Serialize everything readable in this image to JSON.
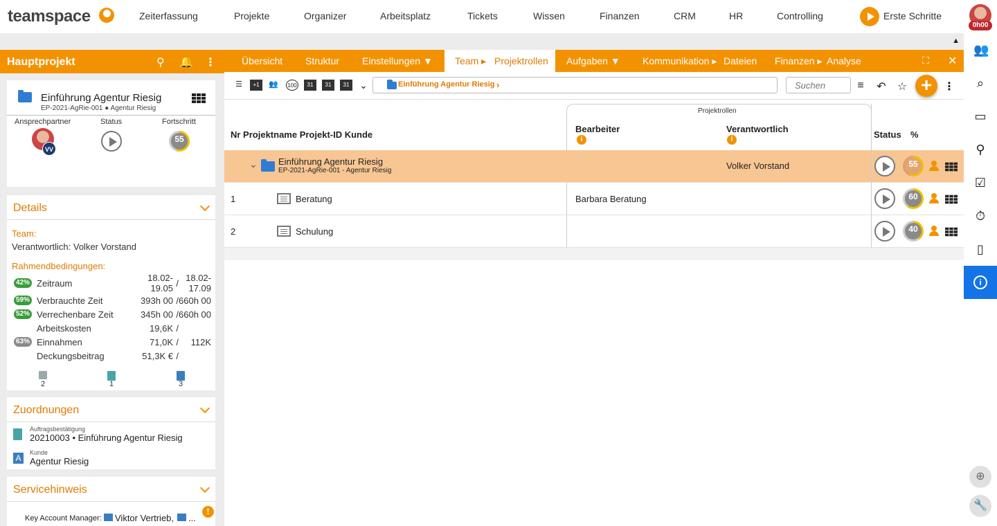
{
  "app": {
    "logo": "teamspace",
    "onboarding": "Erste Schritte",
    "time_badge": "0h00"
  },
  "topnav": [
    "Zeiterfassung",
    "Projekte",
    "Organizer",
    "Arbeitsplatz",
    "Tickets",
    "Wissen",
    "Finanzen",
    "CRM",
    "HR",
    "Controlling"
  ],
  "left": {
    "title": "Hauptprojekt",
    "project": {
      "name": "Einführung Agentur Riesig",
      "sub": "EP-2021-AgRie-001 ● Agentur Riesig"
    },
    "labels": {
      "contact": "Ansprechpartner",
      "status": "Status",
      "progress": "Fortschritt"
    },
    "avatar_initials": "VV",
    "progress_value": "55",
    "details": {
      "title": "Details",
      "team_label": "Team:",
      "responsible": "Verantwortlich: Volker Vorstand",
      "conditions_label": "Rahmendbedingungen:",
      "rows": [
        {
          "pct": "42%",
          "label": "Zeitraum",
          "v1a": "18.02-",
          "v1b": "19.05",
          "sep": "/",
          "v2a": "18.02-",
          "v2b": "17.09"
        },
        {
          "pct": "59%",
          "label": "Verbrauchte Zeit",
          "v1": "393h 00",
          "sep": "/",
          "v2": "660h 00"
        },
        {
          "pct": "52%",
          "label": "Verrechenbare Zeit",
          "v1": "345h 00",
          "sep": "/",
          "v2": "660h 00"
        },
        {
          "pct": "",
          "label": "Arbeitskosten",
          "v1": "19,6K",
          "sep": "/",
          "v2": ""
        },
        {
          "pct": "63%",
          "label": "Einnahmen",
          "v1": "71,0K",
          "sep": "/",
          "v2": "112K"
        },
        {
          "pct": "",
          "label": "Deckungsbeitrag",
          "v1": "51,3K €",
          "sep": "/",
          "v2": ""
        }
      ],
      "counts": [
        "2",
        "1",
        "3"
      ]
    },
    "zuordnungen": {
      "title": "Zuordnungen",
      "order_label": "Auftragsbestätigung",
      "order_value": "20210003 • Einführung Agentur Riesig",
      "customer_label": "Kunde",
      "customer_value": "Agentur Riesig"
    },
    "service": {
      "title": "Servicehinweis",
      "text": "Key Account Manager:",
      "value": "Viktor Vertrieb,",
      "more": "..."
    }
  },
  "tabs": {
    "items": [
      "Übersicht",
      "Struktur",
      "Einstellungen ▼",
      "Team ▸",
      "Projektrollen",
      "Aufgaben ▼",
      "Kommunikation ▸",
      "Dateien",
      "Finanzen ▸",
      "Analyse"
    ]
  },
  "toolbar": {
    "breadcrumb": "Einführung Agentur Riesig",
    "search_placeholder": "Suchen",
    "plus": "+"
  },
  "table": {
    "headers": {
      "left": "Nr Projektname Projekt-ID Kunde",
      "group": "Projektrollen",
      "bearbeiter": "Bearbeiter",
      "verantwortlich": "Verantwortlich",
      "status": "Status",
      "pct": "%"
    },
    "parent": {
      "name": "Einführung Agentur Riesig",
      "sub": "EP-2021-AgRie-001 - Agentur Riesig",
      "verantwortlich": "Volker Vorstand",
      "progress": "55"
    },
    "rows": [
      {
        "nr": "1",
        "name": "Beratung",
        "bearbeiter": "Barbara Beratung",
        "progress": "60"
      },
      {
        "nr": "2",
        "name": "Schulung",
        "bearbeiter": "",
        "progress": "40"
      }
    ]
  },
  "colors": {
    "accent": "#f39200",
    "active_blue": "#1473e6",
    "highlight_row": "#f8c693",
    "green_badge": "#3a9b3a"
  }
}
